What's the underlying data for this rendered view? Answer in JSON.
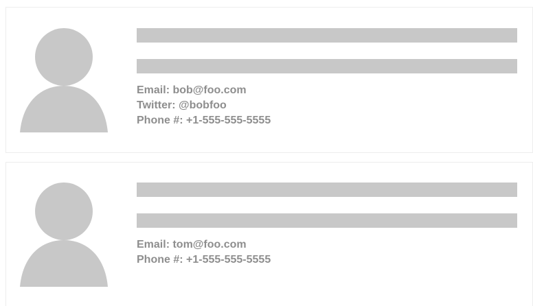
{
  "colors": {
    "placeholder": "#c8c8c8",
    "text": "#8e8e8e",
    "border": "#ededed"
  },
  "contacts": [
    {
      "avatar_icon": "person-silhouette-icon",
      "details": [
        "Email: bob@foo.com",
        "Twitter: @bobfoo",
        "Phone #: +1-555-555-5555"
      ]
    },
    {
      "avatar_icon": "person-silhouette-icon",
      "details": [
        "Email: tom@foo.com",
        "Phone #: +1-555-555-5555"
      ]
    }
  ]
}
